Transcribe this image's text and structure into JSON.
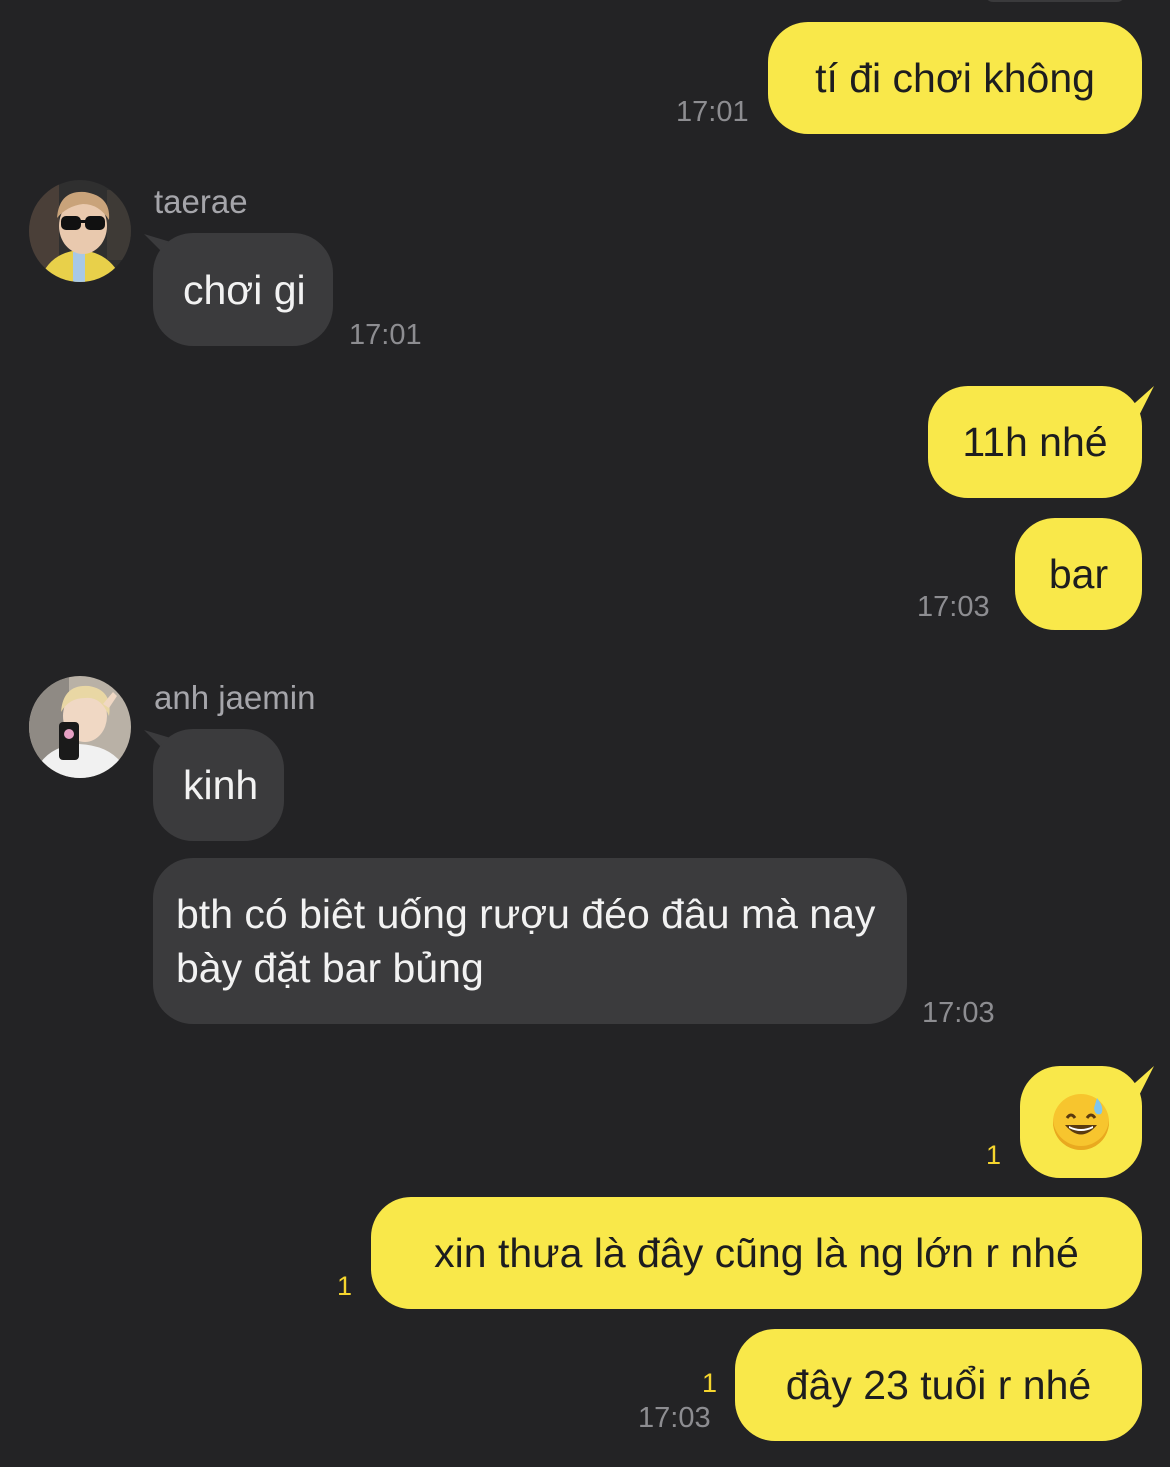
{
  "messages": [
    {
      "text": "tí đi chơi không",
      "time": "17:01"
    },
    {
      "sender": "taerae",
      "text": "chơi gi",
      "time": "17:01"
    },
    {
      "text": "11h nhé"
    },
    {
      "text": "bar",
      "time": "17:03"
    },
    {
      "sender": "anh jaemin",
      "text": "kinh"
    },
    {
      "text": "bth có biêt uống rượu đéo đâu mà nay bày đặt bar bủng",
      "time": "17:03"
    },
    {
      "emoji": "sweat-smile-emoji",
      "unread": "1"
    },
    {
      "text": "xin thưa là đây cũng là ng lớn r nhé",
      "unread": "1"
    },
    {
      "text": "đây 23 tuổi r nhé",
      "unread": "1",
      "time": "17:03"
    }
  ],
  "colors": {
    "background": "#232325",
    "my_bubble": "#f9e84a",
    "their_bubble": "#3b3b3d",
    "timestamp": "#8d8d91",
    "unread": "#f5d52e"
  }
}
